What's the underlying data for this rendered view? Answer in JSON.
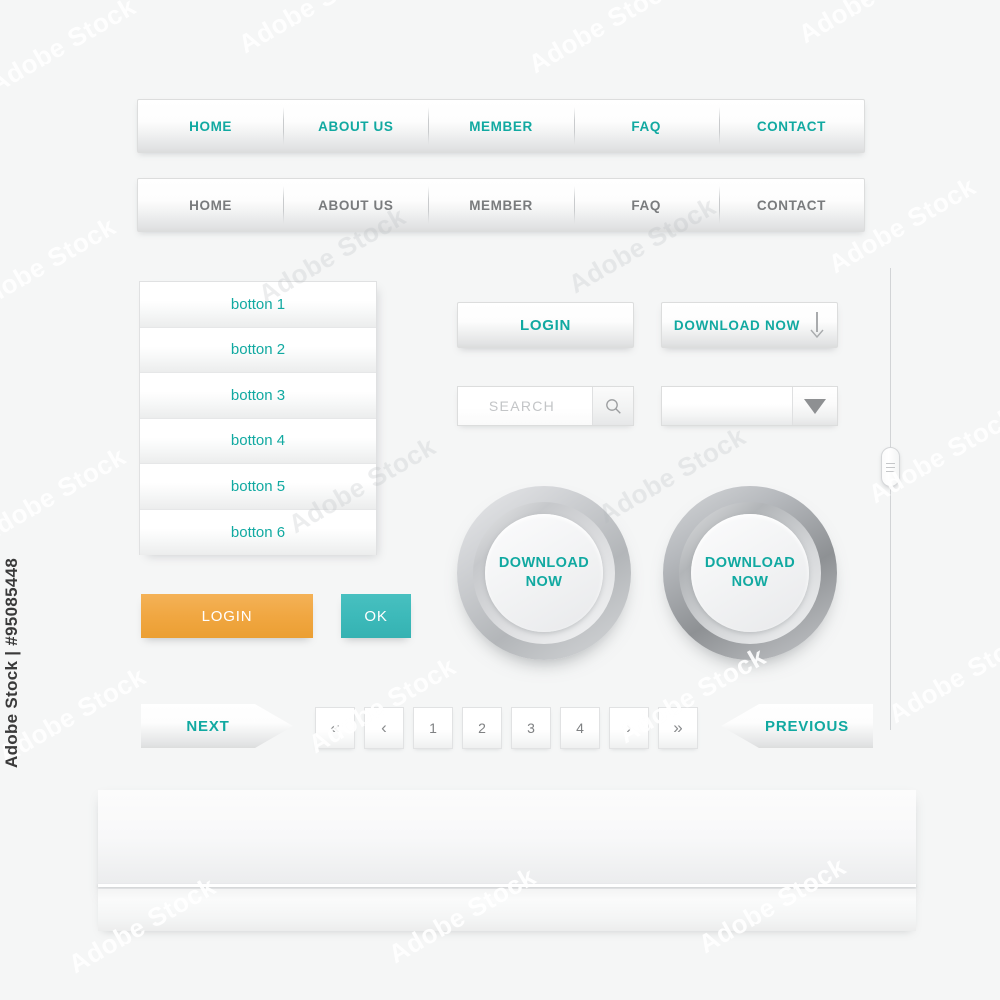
{
  "credit": "Adobe Stock | #95085448",
  "watermark_text": "Adobe Stock",
  "colors": {
    "teal": "#11a9a1",
    "gray_text": "#797b7d",
    "orange": "#f0a73f",
    "teal_flat": "#3cb9b9",
    "background": "#f5f6f6",
    "border": "#dcdddd"
  },
  "navbars": [
    {
      "name": "primary-teal-navbar",
      "style": "teal",
      "items": [
        {
          "label": "HOME"
        },
        {
          "label": "ABOUT US"
        },
        {
          "label": "MEMBER"
        },
        {
          "label": "FAQ"
        },
        {
          "label": "CONTACT"
        }
      ]
    },
    {
      "name": "secondary-gray-navbar",
      "style": "gray",
      "items": [
        {
          "label": "HOME"
        },
        {
          "label": "ABOUT US"
        },
        {
          "label": "MEMBER"
        },
        {
          "label": "FAQ"
        },
        {
          "label": "CONTACT"
        }
      ]
    }
  ],
  "button_list": {
    "items": [
      {
        "label": "botton 1"
      },
      {
        "label": "botton 2"
      },
      {
        "label": "botton 3"
      },
      {
        "label": "botton 4"
      },
      {
        "label": "botton 5"
      },
      {
        "label": "botton 6"
      }
    ]
  },
  "buttons": {
    "login_gray": "LOGIN",
    "download_now_bar": "DOWNLOAD NOW",
    "download_icon": "arrow-down-icon",
    "login_orange": "LOGIN",
    "ok_teal": "OK"
  },
  "search": {
    "placeholder": "SEARCH",
    "value": "",
    "icon": "magnifier-icon"
  },
  "dropdown": {
    "value": "",
    "icon": "triangle-down-icon"
  },
  "circle_buttons": [
    {
      "line1": "DOWNLOAD",
      "line2": "NOW",
      "variant": "light"
    },
    {
      "line1": "DOWNLOAD",
      "line2": "NOW",
      "variant": "dark"
    }
  ],
  "pagination": {
    "next_label": "NEXT",
    "previous_label": "PREVIOUS",
    "controls": [
      {
        "label": "«",
        "name": "first-page",
        "type": "glyph"
      },
      {
        "label": "‹",
        "name": "prev-page",
        "type": "glyph"
      },
      {
        "label": "1",
        "name": "page-1",
        "type": "number"
      },
      {
        "label": "2",
        "name": "page-2",
        "type": "number"
      },
      {
        "label": "3",
        "name": "page-3",
        "type": "number"
      },
      {
        "label": "4",
        "name": "page-4",
        "type": "number"
      },
      {
        "label": "›",
        "name": "next-page",
        "type": "glyph"
      },
      {
        "label": "»",
        "name": "last-page",
        "type": "glyph"
      }
    ]
  },
  "slider": {
    "name": "vertical-slider",
    "handle": "slider-handle"
  }
}
